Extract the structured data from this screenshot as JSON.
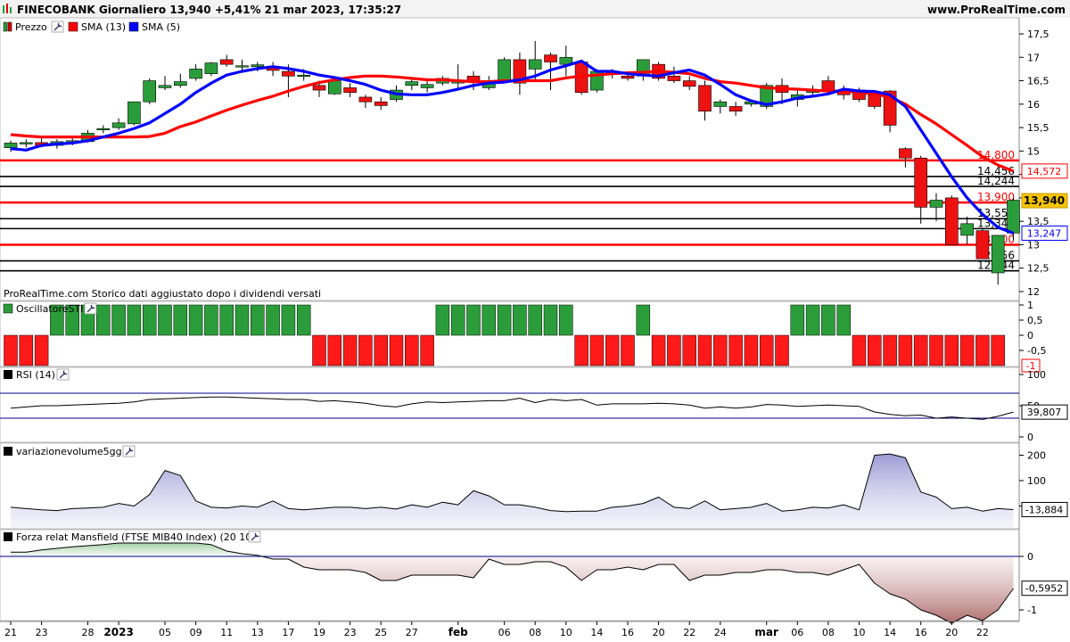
{
  "header": {
    "title": "FINECOBANK Giornaliero 13,940 +5,41% 21 mar 2023, 17:35:27",
    "site": "www.ProRealTime.com"
  },
  "price_panel": {
    "legend": [
      {
        "label": "Prezzo",
        "color": "#2a9d3a",
        "icon": "candle-icon"
      },
      {
        "label": "SMA (13)",
        "color": "#ff0000",
        "icon": "color-square-icon"
      },
      {
        "label": "SMA (5)",
        "color": "#0000ff",
        "icon": "color-square-icon"
      }
    ],
    "footer_note": "ProRealTime.com  Storico dati aggiustato dopo i dividendi versati",
    "ticks": [
      "17,5",
      "17",
      "16,5",
      "16",
      "15,5",
      "15",
      "14,5",
      "14",
      "13,5",
      "13",
      "12,5",
      "12"
    ],
    "levels": [
      {
        "value": 14.8,
        "label": "14,800",
        "type": "red"
      },
      {
        "value": 14.456,
        "label": "14,456",
        "type": "black"
      },
      {
        "value": 14.244,
        "label": "14,244",
        "type": "black"
      },
      {
        "value": 13.9,
        "label": "13,900",
        "type": "red"
      },
      {
        "value": 13.556,
        "label": "13,556",
        "type": "black"
      },
      {
        "value": 13.344,
        "label": "13,344",
        "type": "black"
      },
      {
        "value": 13.0,
        "label": "13,000",
        "type": "red"
      },
      {
        "value": 12.656,
        "label": "12,656",
        "type": "black"
      },
      {
        "value": 12.444,
        "label": "12,444",
        "type": "black"
      }
    ],
    "badges": [
      {
        "value": 14.572,
        "label": "14,572",
        "style": "red-outline"
      },
      {
        "value": 13.94,
        "label": "13,940",
        "style": "gold"
      },
      {
        "value": 13.247,
        "label": "13,247",
        "style": "blue-outline"
      }
    ]
  },
  "osc_panel": {
    "label": "OscillatoreSTI",
    "ticks": [
      "1",
      "0,5",
      "0",
      "-0,5"
    ],
    "badge": "-1",
    "last_value": -1
  },
  "rsi_panel": {
    "label": "RSI (14)",
    "ticks": [
      "100",
      "50",
      "0"
    ],
    "badge": "39,807",
    "bands": [
      70,
      30
    ],
    "last_value": 39.807
  },
  "vol_panel": {
    "label": "variazionevolume5gg",
    "ticks": [
      "200",
      "100",
      "0"
    ],
    "badge": "-13,884",
    "last_value": -13.884
  },
  "mans_panel": {
    "label": "Forza relat Mansfield (FTSE MIB40 Index) (20 10)",
    "ticks": [
      "0",
      "-1"
    ],
    "badge": "-0,5952",
    "last_value": -0.5952
  },
  "x_axis": {
    "labels": [
      {
        "i": 0,
        "t": "21"
      },
      {
        "i": 2,
        "t": "23"
      },
      {
        "i": 5,
        "t": "28"
      },
      {
        "i": 7,
        "t": "2023",
        "bold": true
      },
      {
        "i": 10,
        "t": "05"
      },
      {
        "i": 12,
        "t": "09"
      },
      {
        "i": 14,
        "t": "11"
      },
      {
        "i": 16,
        "t": "13"
      },
      {
        "i": 18,
        "t": "17"
      },
      {
        "i": 20,
        "t": "19"
      },
      {
        "i": 22,
        "t": "23"
      },
      {
        "i": 24,
        "t": "25"
      },
      {
        "i": 26,
        "t": "27"
      },
      {
        "i": 29,
        "t": "feb",
        "bold": true
      },
      {
        "i": 32,
        "t": "06"
      },
      {
        "i": 34,
        "t": "08"
      },
      {
        "i": 36,
        "t": "10"
      },
      {
        "i": 38,
        "t": "14"
      },
      {
        "i": 40,
        "t": "16"
      },
      {
        "i": 42,
        "t": "20"
      },
      {
        "i": 44,
        "t": "22"
      },
      {
        "i": 46,
        "t": "24"
      },
      {
        "i": 49,
        "t": "mar",
        "bold": true
      },
      {
        "i": 51,
        "t": "06"
      },
      {
        "i": 53,
        "t": "08"
      },
      {
        "i": 55,
        "t": "10"
      },
      {
        "i": 57,
        "t": "14"
      },
      {
        "i": 59,
        "t": "16"
      },
      {
        "i": 61,
        "t": "20"
      },
      {
        "i": 63,
        "t": "22"
      }
    ]
  },
  "chart_data": {
    "type": "candlestick",
    "title": "FINECOBANK Giornaliero",
    "ylim": [
      11.85,
      17.75
    ],
    "candles": [
      {
        "o": 15.07,
        "h": 15.22,
        "l": 14.98,
        "c": 15.17
      },
      {
        "o": 15.15,
        "h": 15.25,
        "l": 15.08,
        "c": 15.18
      },
      {
        "o": 15.18,
        "h": 15.3,
        "l": 15.08,
        "c": 15.12
      },
      {
        "o": 15.12,
        "h": 15.25,
        "l": 15.05,
        "c": 15.2
      },
      {
        "o": 15.2,
        "h": 15.28,
        "l": 15.12,
        "c": 15.22
      },
      {
        "o": 15.2,
        "h": 15.45,
        "l": 15.18,
        "c": 15.38
      },
      {
        "o": 15.45,
        "h": 15.55,
        "l": 15.38,
        "c": 15.48
      },
      {
        "o": 15.5,
        "h": 15.7,
        "l": 15.45,
        "c": 15.6
      },
      {
        "o": 15.58,
        "h": 16.05,
        "l": 15.55,
        "c": 16.05
      },
      {
        "o": 16.05,
        "h": 16.55,
        "l": 16.0,
        "c": 16.5
      },
      {
        "o": 16.35,
        "h": 16.6,
        "l": 16.3,
        "c": 16.4
      },
      {
        "o": 16.4,
        "h": 16.65,
        "l": 16.35,
        "c": 16.48
      },
      {
        "o": 16.55,
        "h": 16.85,
        "l": 16.5,
        "c": 16.75
      },
      {
        "o": 16.65,
        "h": 16.9,
        "l": 16.6,
        "c": 16.88
      },
      {
        "o": 16.95,
        "h": 17.05,
        "l": 16.8,
        "c": 16.85
      },
      {
        "o": 16.8,
        "h": 16.95,
        "l": 16.7,
        "c": 16.82
      },
      {
        "o": 16.8,
        "h": 16.9,
        "l": 16.7,
        "c": 16.84
      },
      {
        "o": 16.8,
        "h": 16.9,
        "l": 16.6,
        "c": 16.72
      },
      {
        "o": 16.7,
        "h": 16.85,
        "l": 16.15,
        "c": 16.6
      },
      {
        "o": 16.6,
        "h": 16.75,
        "l": 16.5,
        "c": 16.62
      },
      {
        "o": 16.4,
        "h": 16.5,
        "l": 16.15,
        "c": 16.3
      },
      {
        "o": 16.22,
        "h": 16.55,
        "l": 16.2,
        "c": 16.5
      },
      {
        "o": 16.35,
        "h": 16.45,
        "l": 16.15,
        "c": 16.25
      },
      {
        "o": 16.15,
        "h": 16.2,
        "l": 15.92,
        "c": 16.05
      },
      {
        "o": 16.05,
        "h": 16.15,
        "l": 15.88,
        "c": 15.97
      },
      {
        "o": 16.1,
        "h": 16.4,
        "l": 16.05,
        "c": 16.3
      },
      {
        "o": 16.4,
        "h": 16.55,
        "l": 16.3,
        "c": 16.48
      },
      {
        "o": 16.35,
        "h": 16.5,
        "l": 16.25,
        "c": 16.42
      },
      {
        "o": 16.45,
        "h": 16.6,
        "l": 16.4,
        "c": 16.55
      },
      {
        "o": 16.45,
        "h": 16.85,
        "l": 16.3,
        "c": 16.5
      },
      {
        "o": 16.6,
        "h": 16.7,
        "l": 16.3,
        "c": 16.5
      },
      {
        "o": 16.35,
        "h": 16.6,
        "l": 16.3,
        "c": 16.5
      },
      {
        "o": 16.5,
        "h": 17.0,
        "l": 16.45,
        "c": 16.95
      },
      {
        "o": 16.95,
        "h": 17.1,
        "l": 16.2,
        "c": 16.45
      },
      {
        "o": 16.75,
        "h": 17.35,
        "l": 16.5,
        "c": 16.95
      },
      {
        "o": 17.05,
        "h": 17.1,
        "l": 16.3,
        "c": 16.9
      },
      {
        "o": 16.85,
        "h": 17.25,
        "l": 16.6,
        "c": 17.0
      },
      {
        "o": 16.9,
        "h": 16.95,
        "l": 16.2,
        "c": 16.25
      },
      {
        "o": 16.3,
        "h": 16.75,
        "l": 16.25,
        "c": 16.7
      },
      {
        "o": 16.7,
        "h": 16.75,
        "l": 16.55,
        "c": 16.7
      },
      {
        "o": 16.6,
        "h": 16.7,
        "l": 16.5,
        "c": 16.55
      },
      {
        "o": 16.6,
        "h": 16.8,
        "l": 16.5,
        "c": 16.95
      },
      {
        "o": 16.85,
        "h": 16.9,
        "l": 16.5,
        "c": 16.55
      },
      {
        "o": 16.6,
        "h": 16.8,
        "l": 16.45,
        "c": 16.5
      },
      {
        "o": 16.5,
        "h": 16.6,
        "l": 16.3,
        "c": 16.38
      },
      {
        "o": 16.4,
        "h": 16.5,
        "l": 15.65,
        "c": 15.85
      },
      {
        "o": 15.95,
        "h": 16.1,
        "l": 15.8,
        "c": 16.05
      },
      {
        "o": 15.95,
        "h": 16.05,
        "l": 15.75,
        "c": 15.85
      },
      {
        "o": 16.0,
        "h": 16.1,
        "l": 15.95,
        "c": 16.05
      },
      {
        "o": 15.95,
        "h": 16.45,
        "l": 15.9,
        "c": 16.4
      },
      {
        "o": 16.4,
        "h": 16.55,
        "l": 16.0,
        "c": 16.25
      },
      {
        "o": 16.1,
        "h": 16.3,
        "l": 15.95,
        "c": 16.2
      },
      {
        "o": 16.25,
        "h": 16.4,
        "l": 16.15,
        "c": 16.3
      },
      {
        "o": 16.5,
        "h": 16.6,
        "l": 16.2,
        "c": 16.3
      },
      {
        "o": 16.3,
        "h": 16.4,
        "l": 16.1,
        "c": 16.2
      },
      {
        "o": 16.3,
        "h": 16.35,
        "l": 16.05,
        "c": 16.1
      },
      {
        "o": 16.2,
        "h": 16.28,
        "l": 15.9,
        "c": 15.95
      },
      {
        "o": 16.28,
        "h": 16.3,
        "l": 15.4,
        "c": 15.55
      },
      {
        "o": 15.05,
        "h": 15.08,
        "l": 14.65,
        "c": 14.85
      },
      {
        "o": 14.85,
        "h": 14.9,
        "l": 13.45,
        "c": 13.8
      },
      {
        "o": 13.8,
        "h": 14.1,
        "l": 13.5,
        "c": 13.95
      },
      {
        "o": 14.0,
        "h": 14.05,
        "l": 13.0,
        "c": 13.0
      },
      {
        "o": 13.2,
        "h": 13.6,
        "l": 13.0,
        "c": 13.45
      },
      {
        "o": 13.3,
        "h": 13.35,
        "l": 12.75,
        "c": 12.7
      },
      {
        "o": 12.4,
        "h": 13.2,
        "l": 12.15,
        "c": 13.2
      },
      {
        "o": 13.25,
        "h": 14.0,
        "l": 13.1,
        "c": 13.95
      }
    ],
    "sma13": [
      15.35,
      15.32,
      15.3,
      15.3,
      15.3,
      15.3,
      15.3,
      15.3,
      15.3,
      15.31,
      15.38,
      15.52,
      15.62,
      15.75,
      15.87,
      15.98,
      16.08,
      16.17,
      16.28,
      16.38,
      16.46,
      16.52,
      16.57,
      16.6,
      16.6,
      16.58,
      16.55,
      16.52,
      16.52,
      16.5,
      16.48,
      16.48,
      16.5,
      16.5,
      16.5,
      16.5,
      16.56,
      16.6,
      16.62,
      16.65,
      16.67,
      16.68,
      16.7,
      16.68,
      16.65,
      16.55,
      16.48,
      16.45,
      16.4,
      16.35,
      16.33,
      16.32,
      16.3,
      16.28,
      16.28,
      16.25,
      16.22,
      16.15,
      16.0,
      15.78,
      15.58,
      15.35,
      15.12,
      14.88,
      14.7,
      14.572
    ],
    "sma5": [
      15.05,
      15.02,
      15.12,
      15.15,
      15.17,
      15.22,
      15.3,
      15.38,
      15.48,
      15.6,
      15.8,
      16.0,
      16.25,
      16.45,
      16.62,
      16.7,
      16.76,
      16.8,
      16.76,
      16.7,
      16.62,
      16.57,
      16.5,
      16.42,
      16.3,
      16.22,
      16.2,
      16.2,
      16.25,
      16.32,
      16.4,
      16.45,
      16.47,
      16.52,
      16.6,
      16.73,
      16.82,
      16.92,
      16.7,
      16.7,
      16.65,
      16.62,
      16.6,
      16.67,
      16.73,
      16.62,
      16.42,
      16.2,
      16.07,
      15.99,
      16.05,
      16.13,
      16.17,
      16.22,
      16.32,
      16.28,
      16.27,
      16.2,
      15.95,
      15.45,
      14.95,
      14.45,
      14.0,
      13.65,
      13.37,
      13.247
    ],
    "osc": [
      -1,
      -1,
      -1,
      1,
      1,
      1,
      1,
      1,
      1,
      1,
      1,
      1,
      1,
      1,
      1,
      1,
      1,
      1,
      1,
      1,
      -1,
      -1,
      -1,
      -1,
      -1,
      -1,
      -1,
      -1,
      1,
      1,
      1,
      1,
      1,
      1,
      1,
      1,
      1,
      -1,
      -1,
      -1,
      -1,
      1,
      -1,
      -1,
      -1,
      -1,
      -1,
      -1,
      -1,
      -1,
      -1,
      1,
      1,
      1,
      1,
      -1,
      -1,
      -1,
      -1,
      -1,
      -1,
      -1,
      -1,
      -1,
      -1
    ],
    "rsi": [
      46,
      48,
      50,
      50,
      51,
      52,
      53,
      54,
      56,
      60,
      61,
      62,
      63,
      64,
      64,
      63,
      62,
      61,
      60,
      60,
      57,
      58,
      56,
      54,
      50,
      48,
      53,
      56,
      55,
      56,
      57,
      58,
      58,
      62,
      55,
      60,
      58,
      60,
      51,
      53,
      53,
      53,
      54,
      53,
      51,
      46,
      48,
      46,
      48,
      52,
      51,
      49,
      50,
      51,
      50,
      49,
      40,
      36,
      34,
      35,
      30,
      32,
      30,
      28,
      33,
      39.8
    ],
    "vol": [
      -5,
      -10,
      -15,
      -18,
      -10,
      -8,
      -5,
      10,
      0,
      45,
      140,
      120,
      20,
      -5,
      -8,
      0,
      -5,
      20,
      -10,
      -15,
      -10,
      -5,
      -5,
      -10,
      -5,
      -12,
      5,
      -5,
      15,
      5,
      60,
      40,
      5,
      5,
      -5,
      -18,
      -22,
      -20,
      -20,
      -5,
      0,
      10,
      35,
      -5,
      -10,
      20,
      -15,
      -10,
      -5,
      10,
      -20,
      -15,
      -5,
      -8,
      5,
      -15,
      200,
      205,
      190,
      55,
      35,
      -10,
      -5,
      -20,
      -10,
      -13.9
    ],
    "mansfield": [
      0.08,
      0.08,
      0.12,
      0.15,
      0.18,
      0.2,
      0.22,
      0.25,
      0.25,
      0.25,
      0.25,
      0.25,
      0.25,
      0.22,
      0.1,
      0.05,
      0.02,
      -0.05,
      -0.05,
      -0.2,
      -0.25,
      -0.25,
      -0.25,
      -0.3,
      -0.45,
      -0.45,
      -0.35,
      -0.35,
      -0.35,
      -0.35,
      -0.4,
      -0.05,
      -0.15,
      -0.15,
      -0.1,
      -0.1,
      -0.2,
      -0.45,
      -0.25,
      -0.25,
      -0.2,
      -0.25,
      -0.15,
      -0.15,
      -0.45,
      -0.35,
      -0.35,
      -0.3,
      -0.3,
      -0.25,
      -0.25,
      -0.3,
      -0.3,
      -0.35,
      -0.25,
      -0.15,
      -0.5,
      -0.7,
      -0.8,
      -1.0,
      -1.1,
      -1.25,
      -1.1,
      -1.2,
      -1.0,
      -0.6
    ]
  }
}
